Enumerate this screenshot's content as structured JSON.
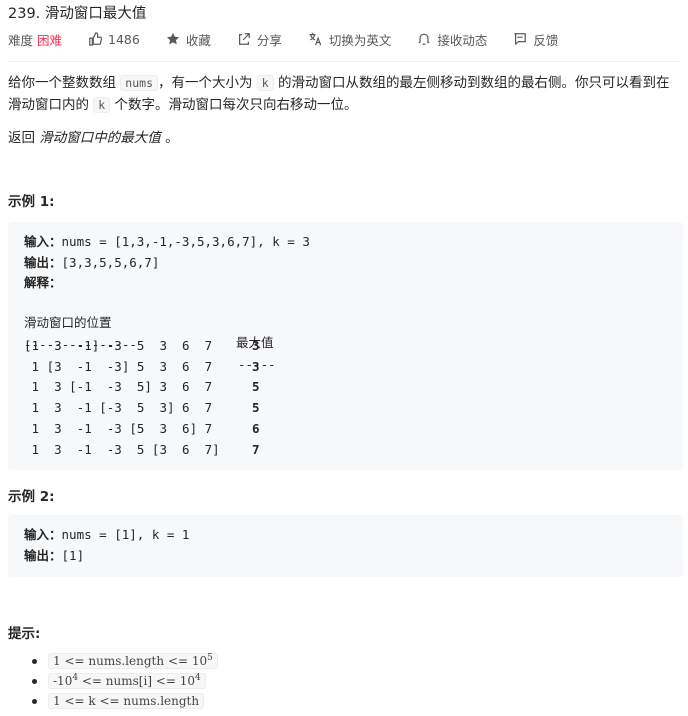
{
  "problem": {
    "title": "239. 滑动窗口最大值",
    "difficulty_label": "难度",
    "difficulty": "困难",
    "likes": "1486",
    "collect_label": "收藏",
    "share_label": "分享",
    "translate_label": "切换为英文",
    "notify_label": "接收动态",
    "feedback_label": "反馈"
  },
  "description": {
    "p1_a": "给你一个整数数组 ",
    "p1_code_nums": "nums",
    "p1_b": "，有一个大小为 ",
    "p1_code_k": "k",
    "p1_c": " 的滑动窗口从数组的最左侧移动到数组的最右侧。你只可以看到在滑动窗口内的 ",
    "p1_code_k2": "k",
    "p1_d": " 个数字。滑动窗口每次只向右移动一位。",
    "returns_a": "返回 ",
    "returns_em": "滑动窗口中的最大值",
    "returns_b": " 。"
  },
  "example1": {
    "heading": "示例 1:",
    "input_label": "输入：",
    "input_value": "nums = [1,3,-1,-3,5,3,6,7], k = 3",
    "output_label": "输出：",
    "output_value": "[3,3,5,5,6,7]",
    "explain_label": "解释：",
    "col_window": "滑动窗口的位置",
    "col_max": "最大值",
    "dash_window": "---------------",
    "dash_max": "-----",
    "rows": [
      {
        "window": "[1  3  -1] -3  5  3  6  7",
        "max": "3"
      },
      {
        "window": " 1 [3  -1  -3] 5  3  6  7",
        "max": "3"
      },
      {
        "window": " 1  3 [-1  -3  5] 3  6  7",
        "max": "5"
      },
      {
        "window": " 1  3  -1 [-3  5  3] 6  7",
        "max": "5"
      },
      {
        "window": " 1  3  -1  -3 [5  3  6] 7",
        "max": "6"
      },
      {
        "window": " 1  3  -1  -3  5 [3  6  7]",
        "max": "7"
      }
    ]
  },
  "example2": {
    "heading": "示例 2:",
    "input_label": "输入：",
    "input_value": "nums = [1], k = 1",
    "output_label": "输出：",
    "output_value": "[1]"
  },
  "constraints": {
    "heading": "提示:",
    "items": [
      {
        "text": "1 <= nums.length <= 10",
        "sup": "5"
      },
      {
        "text_a": "-10",
        "sup_a": "4",
        "text_b": " <= nums[i] <= 10",
        "sup_b": "4"
      },
      {
        "text": "1 <= k <= nums.length"
      }
    ]
  }
}
